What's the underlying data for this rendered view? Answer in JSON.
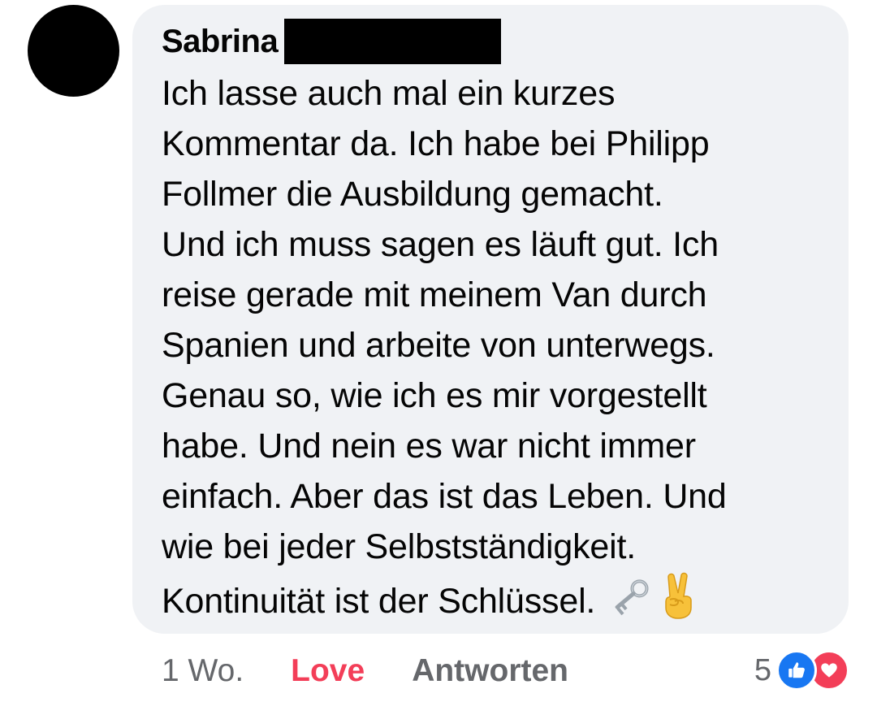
{
  "comment": {
    "author": "Sabrina",
    "lines": [
      "Ich lasse auch mal ein kurzes",
      "Kommentar da. Ich habe bei Philipp",
      "Follmer die Ausbildung gemacht.",
      "Und ich muss sagen es läuft gut. Ich",
      "reise gerade mit meinem Van durch",
      "Spanien und arbeite von unterwegs.",
      "Genau so, wie ich es mir vorgestellt",
      "habe. Und nein es war nicht immer",
      "einfach. Aber das ist das Leben. Und",
      "wie bei jeder Selbstständigkeit.",
      "Kontinuität ist der Schlüssel."
    ],
    "trailing_emojis": [
      "old-key-icon",
      "victory-hand-icon"
    ]
  },
  "meta": {
    "time": "1 Wo.",
    "love_label": "Love",
    "reply_label": "Antworten"
  },
  "reactions": {
    "count": "5",
    "icons": [
      "like-icon",
      "love-icon"
    ]
  },
  "colors": {
    "bubble": "#f0f2f5",
    "text": "#050505",
    "muted": "#65676b",
    "love": "#f33e58",
    "like": "#1877f2"
  }
}
